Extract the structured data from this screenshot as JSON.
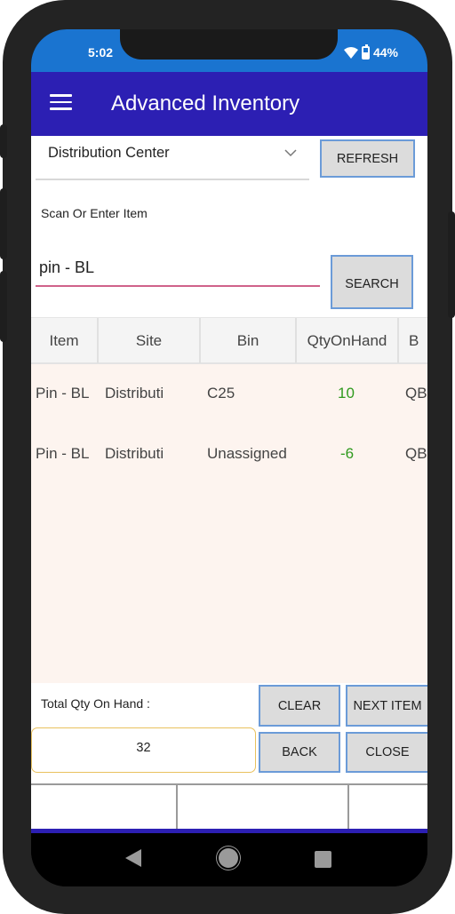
{
  "status_bar": {
    "time": "5:02",
    "battery": "44%",
    "icons": [
      "wifi-icon",
      "battery-icon"
    ]
  },
  "app_bar": {
    "title": "Advanced Inventory",
    "menu_icon": "menu-icon"
  },
  "site_select": {
    "selected": "Distribution Center",
    "icon": "chevron-down-icon"
  },
  "buttons": {
    "refresh": "REFRESH",
    "search": "SEARCH",
    "clear": "CLEAR",
    "next_item": "NEXT ITEM",
    "back": "BACK",
    "close": "CLOSE"
  },
  "scan": {
    "label": "Scan Or Enter Item",
    "value": "pin - BL"
  },
  "grid": {
    "columns": [
      "Item",
      "Site",
      "Bin",
      "QtyOnHand",
      "B"
    ],
    "rows": [
      {
        "item": "Pin - BL",
        "site": "Distributi",
        "bin": "C25",
        "qty": "10",
        "b": "QB"
      },
      {
        "item": "Pin - BL",
        "site": "Distributi",
        "bin": "Unassigned",
        "qty": "-6",
        "b": "QB"
      }
    ]
  },
  "total": {
    "label": "Total Qty On Hand :",
    "value": "32"
  },
  "colors": {
    "status_bar": "#1a74d0",
    "app_bar": "#2c1fb3",
    "qty_text": "#2f9a1e",
    "grid_body": "#fdf4ef",
    "input_underline": "#d0628a",
    "button_border": "#6b9bd8"
  }
}
